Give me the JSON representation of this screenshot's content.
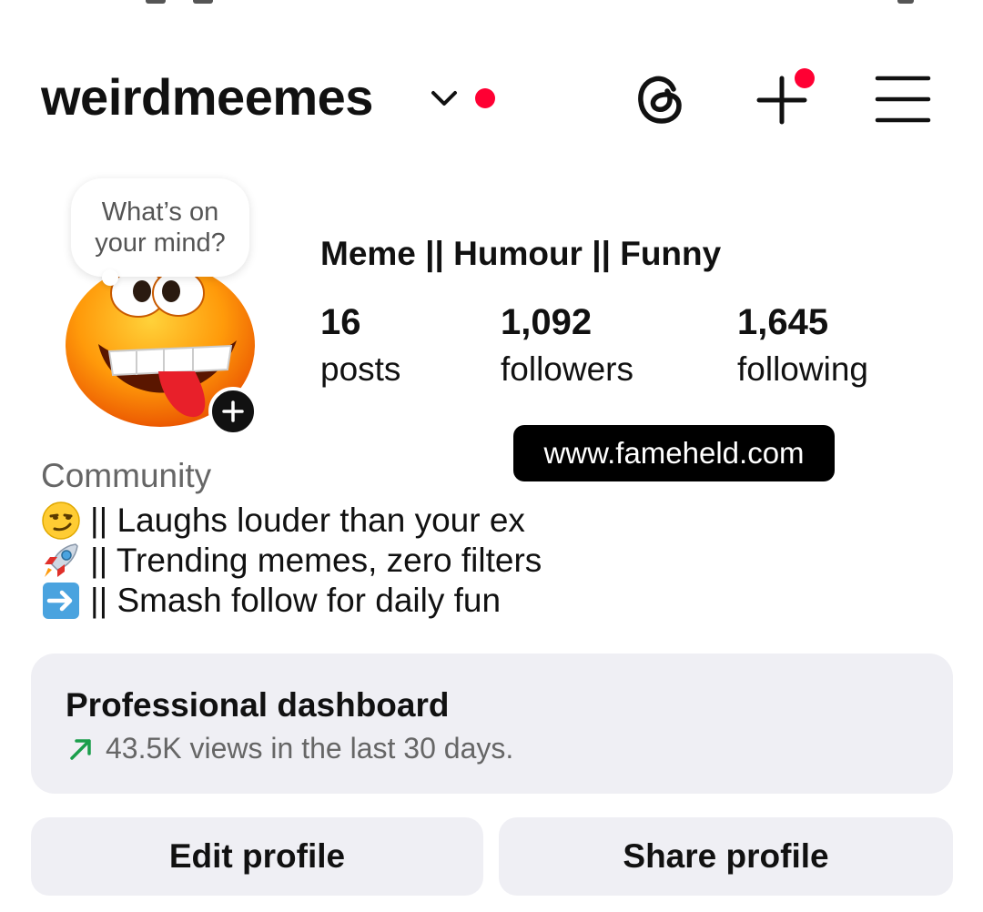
{
  "header": {
    "username": "weirdmeemes",
    "icons": [
      "chevron-down-icon",
      "threads-icon",
      "plus-icon",
      "menu-icon"
    ],
    "notification_color": "#ff0033"
  },
  "note": {
    "text": "What’s on your mind?"
  },
  "profile": {
    "display_name": "Meme || Humour || Funny",
    "stats": [
      {
        "value": "16",
        "label": "posts"
      },
      {
        "value": "1,092",
        "label": "followers"
      },
      {
        "value": "1,645",
        "label": "following"
      }
    ],
    "link": "www.fameheld.com",
    "category": "Community",
    "bio": [
      {
        "emoji": "smirking-face-emoji",
        "text": "|| Laughs louder than your ex"
      },
      {
        "emoji": "rocket-emoji",
        "text": "|| Trending memes, zero filters"
      },
      {
        "emoji": "right-arrow-emoji",
        "text": "|| Smash follow for daily fun"
      }
    ]
  },
  "dashboard": {
    "title": "Professional dashboard",
    "subtitle": "43.5K views in the last 30 days.",
    "trend_color": "#1a9e4b"
  },
  "actions": {
    "edit_label": "Edit profile",
    "share_label": "Share profile"
  }
}
